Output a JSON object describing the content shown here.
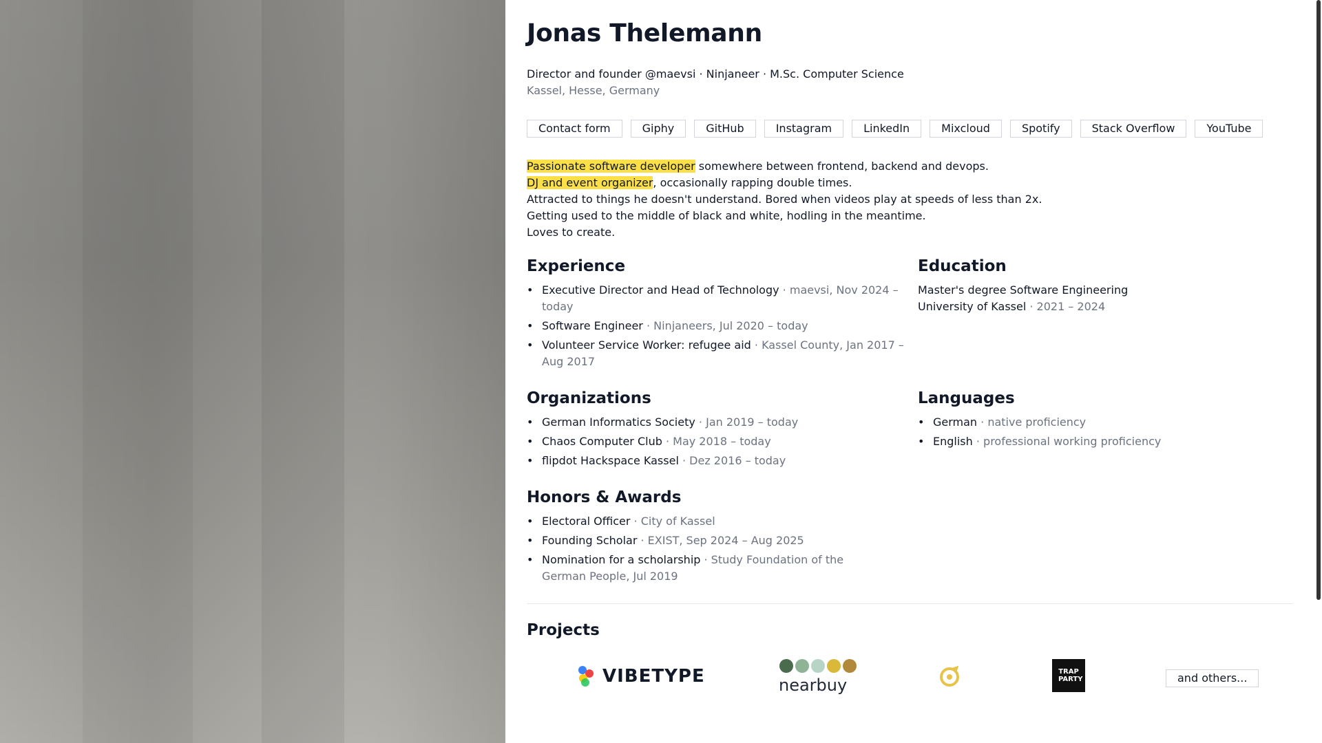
{
  "profile": {
    "name": "Jonas Thelemann",
    "tagline": "Director and founder @maevsi · Ninjaneer · M.Sc. Computer Science",
    "location": "Kassel, Hesse, Germany"
  },
  "links": [
    "Contact form",
    "Giphy",
    "GitHub",
    "Instagram",
    "LinkedIn",
    "Mixcloud",
    "Spotify",
    "Stack Overflow",
    "YouTube"
  ],
  "bio": {
    "line1_highlight": "Passionate software developer",
    "line1_rest": " somewhere between frontend, backend and devops.",
    "line2_highlight": "DJ and event organizer",
    "line2_rest": ", occasionally rapping double times.",
    "line3": "Attracted to things he doesn't understand. Bored when videos play at speeds of less than 2x.",
    "line4": "Getting used to the middle of black and white, hodling in the meantime.",
    "line5": "Loves to create."
  },
  "experience": {
    "title": "Experience",
    "items": [
      {
        "role": "Executive Director and Head of Technology",
        "meta": " · maevsi, Nov 2024 – today"
      },
      {
        "role": "Software Engineer",
        "meta": " · Ninjaneers, Jul 2020 – today"
      },
      {
        "role": "Volunteer Service Worker: refugee aid",
        "meta": " · Kassel County, Jan 2017 – Aug 2017"
      }
    ]
  },
  "education": {
    "title": "Education",
    "degree": "Master's degree Software Engineering",
    "school": "University of Kassel",
    "years": " · 2021 – 2024"
  },
  "organizations": {
    "title": "Organizations",
    "items": [
      {
        "name": "German Informatics Society",
        "meta": " · Jan 2019 – today"
      },
      {
        "name": "Chaos Computer Club",
        "meta": " · May 2018 – today"
      },
      {
        "name": "flipdot Hackspace Kassel",
        "meta": " · Dez 2016 – today"
      }
    ]
  },
  "languages": {
    "title": "Languages",
    "items": [
      {
        "name": "German",
        "meta": " · native proficiency"
      },
      {
        "name": "English",
        "meta": " · professional working proficiency"
      }
    ]
  },
  "honors": {
    "title": "Honors & Awards",
    "items": [
      {
        "name": "Electoral Officer",
        "meta": " · City of Kassel"
      },
      {
        "name": "Founding Scholar",
        "meta": " · EXIST, Sep 2024 – Aug 2025"
      },
      {
        "name": "Nomination for a scholarship",
        "meta": " · Study Foundation of the German People, Jul 2019"
      }
    ]
  },
  "projects": {
    "title": "Projects",
    "vibetype_wordmark": "VIBETYPE",
    "nearbuy_wordmark": "nearbuy",
    "trapparty_text": "TRAP PARTY",
    "others_label": "and others..."
  },
  "colors": {
    "highlight": "#fde047",
    "muted": "#6b7280",
    "nearbuy_dots": [
      "#4a6b4d",
      "#8fb394",
      "#b8d4c4",
      "#d9b83a",
      "#b08a3a"
    ],
    "accent_yellow": "#e7c34a"
  }
}
